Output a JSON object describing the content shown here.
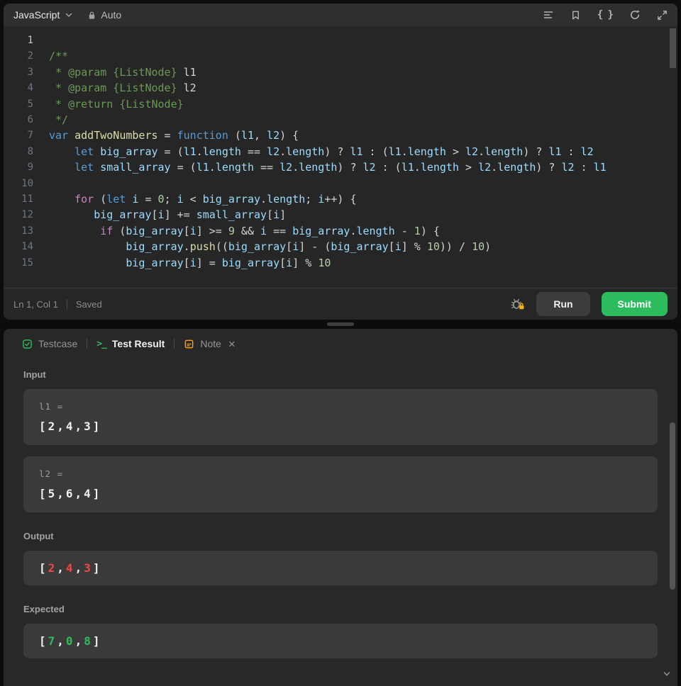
{
  "colors": {
    "accent_green": "#2cbb5d",
    "error_red": "#ef4743",
    "note_orange": "#ffa116",
    "editor_bg": "#262626",
    "panel_bg": "#282828",
    "box_bg": "#3a3a3a"
  },
  "header": {
    "language": "JavaScript",
    "auto_label": "Auto",
    "icons": [
      "chevron-down-icon",
      "lock-icon",
      "format-lines-icon",
      "bookmark-icon",
      "braces-icon",
      "reset-icon",
      "collapse-icon"
    ]
  },
  "editor": {
    "lines": [
      {
        "n": 1,
        "a": true,
        "t": []
      },
      {
        "n": 2,
        "t": [
          [
            "c",
            "/**"
          ]
        ]
      },
      {
        "n": 3,
        "t": [
          [
            "c",
            " * @param {ListNode}"
          ],
          [
            "p",
            " l1"
          ]
        ]
      },
      {
        "n": 4,
        "t": [
          [
            "c",
            " * @param {ListNode}"
          ],
          [
            "p",
            " l2"
          ]
        ]
      },
      {
        "n": 5,
        "t": [
          [
            "c",
            " * @return {ListNode}"
          ]
        ]
      },
      {
        "n": 6,
        "t": [
          [
            "c",
            " */"
          ]
        ]
      },
      {
        "n": 7,
        "t": [
          [
            "k",
            "var "
          ],
          [
            "y",
            "addTwoNumbers"
          ],
          [
            "p",
            " = "
          ],
          [
            "k",
            "function "
          ],
          [
            "p",
            "("
          ],
          [
            "v",
            "l1"
          ],
          [
            "p",
            ", "
          ],
          [
            "v",
            "l2"
          ],
          [
            "p",
            ") {"
          ]
        ]
      },
      {
        "n": 8,
        "t": [
          [
            "p",
            "    "
          ],
          [
            "k",
            "let "
          ],
          [
            "v",
            "big_array"
          ],
          [
            "p",
            " = ("
          ],
          [
            "v",
            "l1"
          ],
          [
            "p",
            "."
          ],
          [
            "v",
            "length"
          ],
          [
            "p",
            " == "
          ],
          [
            "v",
            "l2"
          ],
          [
            "p",
            "."
          ],
          [
            "v",
            "length"
          ],
          [
            "p",
            ") ? "
          ],
          [
            "v",
            "l1"
          ],
          [
            "p",
            " : ("
          ],
          [
            "v",
            "l1"
          ],
          [
            "p",
            "."
          ],
          [
            "v",
            "length"
          ],
          [
            "p",
            " > "
          ],
          [
            "v",
            "l2"
          ],
          [
            "p",
            "."
          ],
          [
            "v",
            "length"
          ],
          [
            "p",
            ") ? "
          ],
          [
            "v",
            "l1"
          ],
          [
            "p",
            " : "
          ],
          [
            "v",
            "l2"
          ]
        ]
      },
      {
        "n": 9,
        "t": [
          [
            "p",
            "    "
          ],
          [
            "k",
            "let "
          ],
          [
            "v",
            "small_array"
          ],
          [
            "p",
            " = ("
          ],
          [
            "v",
            "l1"
          ],
          [
            "p",
            "."
          ],
          [
            "v",
            "length"
          ],
          [
            "p",
            " == "
          ],
          [
            "v",
            "l2"
          ],
          [
            "p",
            "."
          ],
          [
            "v",
            "length"
          ],
          [
            "p",
            ") ? "
          ],
          [
            "v",
            "l2"
          ],
          [
            "p",
            " : ("
          ],
          [
            "v",
            "l1"
          ],
          [
            "p",
            "."
          ],
          [
            "v",
            "length"
          ],
          [
            "p",
            " > "
          ],
          [
            "v",
            "l2"
          ],
          [
            "p",
            "."
          ],
          [
            "v",
            "length"
          ],
          [
            "p",
            ") ? "
          ],
          [
            "v",
            "l2"
          ],
          [
            "p",
            " : "
          ],
          [
            "v",
            "l1"
          ]
        ]
      },
      {
        "n": 10,
        "t": []
      },
      {
        "n": 11,
        "t": [
          [
            "p",
            "    "
          ],
          [
            "f",
            "for"
          ],
          [
            "p",
            " ("
          ],
          [
            "k",
            "let "
          ],
          [
            "v",
            "i"
          ],
          [
            "p",
            " = "
          ],
          [
            "n",
            "0"
          ],
          [
            "p",
            "; "
          ],
          [
            "v",
            "i"
          ],
          [
            "p",
            " < "
          ],
          [
            "v",
            "big_array"
          ],
          [
            "p",
            "."
          ],
          [
            "v",
            "length"
          ],
          [
            "p",
            "; "
          ],
          [
            "v",
            "i"
          ],
          [
            "p",
            "++) {"
          ]
        ]
      },
      {
        "n": 12,
        "t": [
          [
            "p",
            "       "
          ],
          [
            "v",
            "big_array"
          ],
          [
            "p",
            "["
          ],
          [
            "v",
            "i"
          ],
          [
            "p",
            "] += "
          ],
          [
            "v",
            "small_array"
          ],
          [
            "p",
            "["
          ],
          [
            "v",
            "i"
          ],
          [
            "p",
            "]"
          ]
        ]
      },
      {
        "n": 13,
        "t": [
          [
            "p",
            "        "
          ],
          [
            "f",
            "if"
          ],
          [
            "p",
            " ("
          ],
          [
            "v",
            "big_array"
          ],
          [
            "p",
            "["
          ],
          [
            "v",
            "i"
          ],
          [
            "p",
            "] >= "
          ],
          [
            "n",
            "9"
          ],
          [
            "p",
            " && "
          ],
          [
            "v",
            "i"
          ],
          [
            "p",
            " == "
          ],
          [
            "v",
            "big_array"
          ],
          [
            "p",
            "."
          ],
          [
            "v",
            "length"
          ],
          [
            "p",
            " - "
          ],
          [
            "n",
            "1"
          ],
          [
            "p",
            ") {"
          ]
        ]
      },
      {
        "n": 14,
        "t": [
          [
            "p",
            "            "
          ],
          [
            "v",
            "big_array"
          ],
          [
            "p",
            "."
          ],
          [
            "y",
            "push"
          ],
          [
            "p",
            "(("
          ],
          [
            "v",
            "big_array"
          ],
          [
            "p",
            "["
          ],
          [
            "v",
            "i"
          ],
          [
            "p",
            "] - ("
          ],
          [
            "v",
            "big_array"
          ],
          [
            "p",
            "["
          ],
          [
            "v",
            "i"
          ],
          [
            "p",
            "] % "
          ],
          [
            "n",
            "10"
          ],
          [
            "p",
            ")) / "
          ],
          [
            "n",
            "10"
          ],
          [
            "p",
            ")"
          ]
        ]
      },
      {
        "n": 15,
        "t": [
          [
            "p",
            "            "
          ],
          [
            "v",
            "big_array"
          ],
          [
            "p",
            "["
          ],
          [
            "v",
            "i"
          ],
          [
            "p",
            "] = "
          ],
          [
            "v",
            "big_array"
          ],
          [
            "p",
            "["
          ],
          [
            "v",
            "i"
          ],
          [
            "p",
            "] % "
          ],
          [
            "n",
            "10"
          ]
        ]
      }
    ]
  },
  "footer": {
    "cursor_position": "Ln 1, Col 1",
    "saved_status": "Saved",
    "run_label": "Run",
    "submit_label": "Submit"
  },
  "panel": {
    "tabs": [
      {
        "label": "Testcase",
        "icon": "checkbox-icon",
        "active": false
      },
      {
        "label": "Test Result",
        "icon": "terminal-icon",
        "active": true
      },
      {
        "label": "Note",
        "icon": "note-icon",
        "active": false
      }
    ],
    "input_label": "Input",
    "cases": [
      {
        "label": "l1 =",
        "value": "[2,4,3]"
      },
      {
        "label": "l2 =",
        "value": "[5,6,4]"
      }
    ],
    "output_label": "Output",
    "output_value": "[2,4,3]",
    "expected_label": "Expected",
    "expected_value": "[7,0,8]"
  }
}
